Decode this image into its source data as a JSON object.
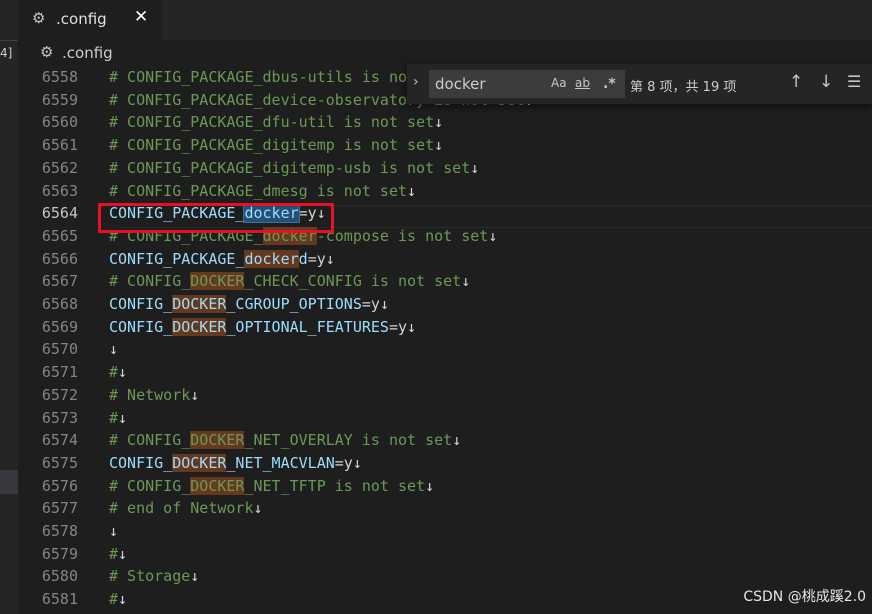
{
  "sidebar": {
    "partial_label": "4]"
  },
  "tab": {
    "icon": "gear-icon",
    "label": ".config",
    "close_glyph": "✕"
  },
  "breadcrumb": {
    "icon": "gear-icon",
    "label": ".config"
  },
  "find_widget": {
    "query": "docker",
    "match_case_label": "Aa",
    "whole_word_label": "ab",
    "regex_label": ".*",
    "result_text": "第 8 项，共 19 项",
    "current_match": 8,
    "total_matches": 19
  },
  "editor": {
    "active_line": 6564,
    "lines": [
      {
        "num": "6558",
        "segments": [
          {
            "t": "# CONFIG_PACKAGE_dbus-utils is not set",
            "c": "cm"
          }
        ]
      },
      {
        "num": "6559",
        "segments": [
          {
            "t": "# CONFIG_PACKAGE_device-observatory is not set",
            "c": "cm"
          },
          {
            "t": "↓",
            "c": "nl"
          }
        ]
      },
      {
        "num": "6560",
        "segments": [
          {
            "t": "# CONFIG_PACKAGE_dfu-util is not set",
            "c": "cm"
          },
          {
            "t": "↓",
            "c": "nl"
          }
        ]
      },
      {
        "num": "6561",
        "segments": [
          {
            "t": "# CONFIG_PACKAGE_digitemp is not set",
            "c": "cm"
          },
          {
            "t": "↓",
            "c": "nl"
          }
        ]
      },
      {
        "num": "6562",
        "segments": [
          {
            "t": "# CONFIG_PACKAGE_digitemp-usb is not set",
            "c": "cm"
          },
          {
            "t": "↓",
            "c": "nl"
          }
        ]
      },
      {
        "num": "6563",
        "segments": [
          {
            "t": "# CONFIG_PACKAGE_dmesg is not set",
            "c": "cm"
          },
          {
            "t": "↓",
            "c": "nl"
          }
        ]
      },
      {
        "num": "6564",
        "segments": [
          {
            "t": "CONFIG_PACKAGE_",
            "c": "vr"
          },
          {
            "t": "docker",
            "c": "vr curmatch"
          },
          {
            "t": "=y",
            "c": "tx"
          },
          {
            "t": "↓",
            "c": "nl"
          }
        ]
      },
      {
        "num": "6565",
        "segments": [
          {
            "t": "# CONFIG_PACKAGE_",
            "c": "cm"
          },
          {
            "t": "docker",
            "c": "cm match"
          },
          {
            "t": "-compose is not set",
            "c": "cm"
          },
          {
            "t": "↓",
            "c": "nl"
          }
        ]
      },
      {
        "num": "6566",
        "segments": [
          {
            "t": "CONFIG_PACKAGE_",
            "c": "vr"
          },
          {
            "t": "docker",
            "c": "vr match"
          },
          {
            "t": "d",
            "c": "vr"
          },
          {
            "t": "=y",
            "c": "tx"
          },
          {
            "t": "↓",
            "c": "nl"
          }
        ]
      },
      {
        "num": "6567",
        "segments": [
          {
            "t": "# CONFIG_",
            "c": "cm"
          },
          {
            "t": "DOCKER",
            "c": "cm match"
          },
          {
            "t": "_CHECK_CONFIG is not set",
            "c": "cm"
          },
          {
            "t": "↓",
            "c": "nl"
          }
        ]
      },
      {
        "num": "6568",
        "segments": [
          {
            "t": "CONFIG_",
            "c": "vr"
          },
          {
            "t": "DOCKER",
            "c": "vr match"
          },
          {
            "t": "_CGROUP_OPTIONS",
            "c": "vr"
          },
          {
            "t": "=y",
            "c": "tx"
          },
          {
            "t": "↓",
            "c": "nl"
          }
        ]
      },
      {
        "num": "6569",
        "segments": [
          {
            "t": "CONFIG_",
            "c": "vr"
          },
          {
            "t": "DOCKER",
            "c": "vr match"
          },
          {
            "t": "_OPTIONAL_FEATURES",
            "c": "vr"
          },
          {
            "t": "=y",
            "c": "tx"
          },
          {
            "t": "↓",
            "c": "nl"
          }
        ]
      },
      {
        "num": "6570",
        "segments": [
          {
            "t": "↓",
            "c": "nl"
          }
        ]
      },
      {
        "num": "6571",
        "segments": [
          {
            "t": "#",
            "c": "cm"
          },
          {
            "t": "↓",
            "c": "nl"
          }
        ]
      },
      {
        "num": "6572",
        "segments": [
          {
            "t": "# Network",
            "c": "cm"
          },
          {
            "t": "↓",
            "c": "nl"
          }
        ]
      },
      {
        "num": "6573",
        "segments": [
          {
            "t": "#",
            "c": "cm"
          },
          {
            "t": "↓",
            "c": "nl"
          }
        ]
      },
      {
        "num": "6574",
        "segments": [
          {
            "t": "# CONFIG_",
            "c": "cm"
          },
          {
            "t": "DOCKER",
            "c": "cm match"
          },
          {
            "t": "_NET_OVERLAY is not set",
            "c": "cm"
          },
          {
            "t": "↓",
            "c": "nl"
          }
        ]
      },
      {
        "num": "6575",
        "segments": [
          {
            "t": "CONFIG_",
            "c": "vr"
          },
          {
            "t": "DOCKER",
            "c": "vr match"
          },
          {
            "t": "_NET_MACVLAN",
            "c": "vr"
          },
          {
            "t": "=y",
            "c": "tx"
          },
          {
            "t": "↓",
            "c": "nl"
          }
        ]
      },
      {
        "num": "6576",
        "segments": [
          {
            "t": "# CONFIG_",
            "c": "cm"
          },
          {
            "t": "DOCKER",
            "c": "cm match"
          },
          {
            "t": "_NET_TFTP is not set",
            "c": "cm"
          },
          {
            "t": "↓",
            "c": "nl"
          }
        ]
      },
      {
        "num": "6577",
        "segments": [
          {
            "t": "# end of Network",
            "c": "cm"
          },
          {
            "t": "↓",
            "c": "nl"
          }
        ]
      },
      {
        "num": "6578",
        "segments": [
          {
            "t": "↓",
            "c": "nl"
          }
        ]
      },
      {
        "num": "6579",
        "segments": [
          {
            "t": "#",
            "c": "cm"
          },
          {
            "t": "↓",
            "c": "nl"
          }
        ]
      },
      {
        "num": "6580",
        "segments": [
          {
            "t": "# Storage",
            "c": "cm"
          },
          {
            "t": "↓",
            "c": "nl"
          }
        ]
      },
      {
        "num": "6581",
        "segments": [
          {
            "t": "#",
            "c": "cm"
          },
          {
            "t": "↓",
            "c": "nl"
          }
        ]
      }
    ]
  },
  "watermark": "CSDN @桃成蹊2.0",
  "colors": {
    "background": "#1e1e1e",
    "comment": "#6a9955",
    "variable": "#9cdcfe",
    "highlight_box": "#e81123",
    "match_highlight": "#964b1e",
    "current_match": "#264f78"
  }
}
